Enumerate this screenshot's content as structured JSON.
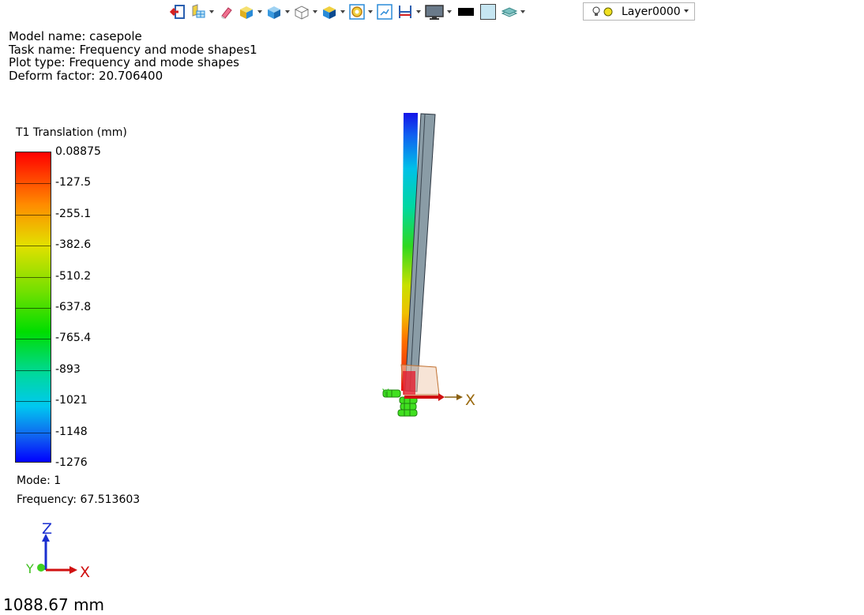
{
  "toolbar": {
    "tools": [
      {
        "name": "exit-icon",
        "color": "#d42020"
      },
      {
        "name": "mesh-icon",
        "color": "#2a8bd8"
      },
      {
        "name": "eraser-icon",
        "color": "#e04060"
      },
      {
        "name": "shaded-box-icon",
        "color": "#e8c020"
      },
      {
        "name": "solid-box-icon",
        "color": "#2a8bd8"
      },
      {
        "name": "wire-box-icon",
        "color": "#888888"
      },
      {
        "name": "iso-view-icon",
        "color": "#2a8bd8"
      },
      {
        "name": "target-icon",
        "color": "#e8a020"
      },
      {
        "name": "fit-view-icon",
        "color": "#2a8bd8"
      },
      {
        "name": "section-icon",
        "color": "#d42020"
      },
      {
        "name": "monitor-icon",
        "color": "#555555"
      },
      {
        "name": "black-color-swatch",
        "color": "#000000"
      },
      {
        "name": "light-blue-color-swatch",
        "color": "#c6e6f2"
      },
      {
        "name": "layers-icon",
        "color": "#2a9a9a"
      }
    ],
    "layer": {
      "name": "Layer0000"
    }
  },
  "info": {
    "model_name": "Model name: casepole",
    "task_name": "Task name: Frequency and mode shapes1",
    "plot_type": "Plot type: Frequency and mode shapes",
    "deform_factor": "Deform factor: 20.706400"
  },
  "legend": {
    "title": "T1 Translation (mm)",
    "labels": [
      "0.08875",
      "-127.5",
      "-255.1",
      "-382.6",
      "-510.2",
      "-637.8",
      "-765.4",
      "-893",
      "-1021",
      "-1148",
      "-1276"
    ],
    "colors": {
      "max": "#ff0000",
      "min": "#0000ff"
    }
  },
  "result": {
    "mode": "Mode: 1",
    "frequency": "Frequency: 67.513603"
  },
  "axes": {
    "x": "X",
    "y": "Y",
    "z": "Z"
  },
  "scale_text": "1088.67 mm"
}
